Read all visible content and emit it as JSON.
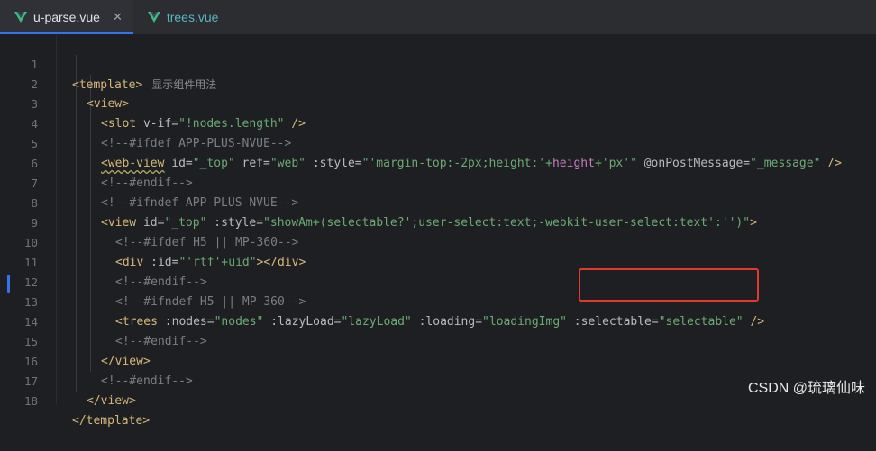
{
  "tabs": [
    {
      "label": "u-parse.vue",
      "active": true,
      "icon": "vue-icon"
    },
    {
      "label": "trees.vue",
      "active": false,
      "icon": "vue-icon"
    }
  ],
  "editor": {
    "hint": "显示组件用法",
    "line_numbers": [
      "1",
      "2",
      "3",
      "4",
      "5",
      "6",
      "7",
      "8",
      "9",
      "10",
      "11",
      "12",
      "13",
      "14",
      "15",
      "16",
      "17",
      "18"
    ],
    "lines": {
      "l1_open": "<template>",
      "l2_view": "<view>",
      "l3_slot": "<slot",
      "l3_attr": " v-if=",
      "l3_val": "\"!nodes.length\"",
      "l3_close": " />",
      "l4": "<!--#ifdef APP-PLUS-NVUE-->",
      "l5_tag": "<web-view",
      "l5_a1": " id=",
      "l5_v1": "\"_top\"",
      "l5_a2": " ref=",
      "l5_v2": "\"web\"",
      "l5_a3": " :style=",
      "l5_v3a": "\"'margin-top:-2px;height:'+",
      "l5_v3b": "height",
      "l5_v3c": "+'px'\"",
      "l5_a4": " @onPostMessage=",
      "l5_v4": "\"_message\"",
      "l5_close": " />",
      "l6": "<!--#endif-->",
      "l7": "<!--#ifndef APP-PLUS-NVUE-->",
      "l8_tag": "<view",
      "l8_a1": " id=",
      "l8_v1": "\"_top\"",
      "l8_a2": " :style=",
      "l8_v2a": "\"showAm+(selectable?';user-select:text;-webkit-user-select:text':'')\"",
      "l8_close": ">",
      "l9": "<!--#ifdef H5 || MP-360-->",
      "l10_tag": "<div",
      "l10_a1": " :id=",
      "l10_v1": "\"'rtf'+uid\"",
      "l10_close": "></div>",
      "l11": "<!--#endif-->",
      "l12": "<!--#ifndef H5 || MP-360-->",
      "l13_tag": "<trees",
      "l13_a1": " :nodes=",
      "l13_v1": "\"nodes\"",
      "l13_a2": " :lazyLoad=",
      "l13_v2": "\"lazyLoad\"",
      "l13_a3": " :loading=",
      "l13_v3": "\"loadingImg\"",
      "l13_a4": " :selectable=",
      "l13_v4": "\"selectable\"",
      "l13_close": " />",
      "l14": "<!--#endif-->",
      "l15": "</view>",
      "l16": "<!--#endif-->",
      "l17": "</view>",
      "l18": "</template>"
    }
  },
  "watermark": "CSDN @琉璃仙味",
  "colors": {
    "accent": "#3574f0",
    "highlight": "#e03a2f",
    "tag": "#d5b778",
    "string": "#6aab73",
    "comment": "#7a7e85"
  }
}
